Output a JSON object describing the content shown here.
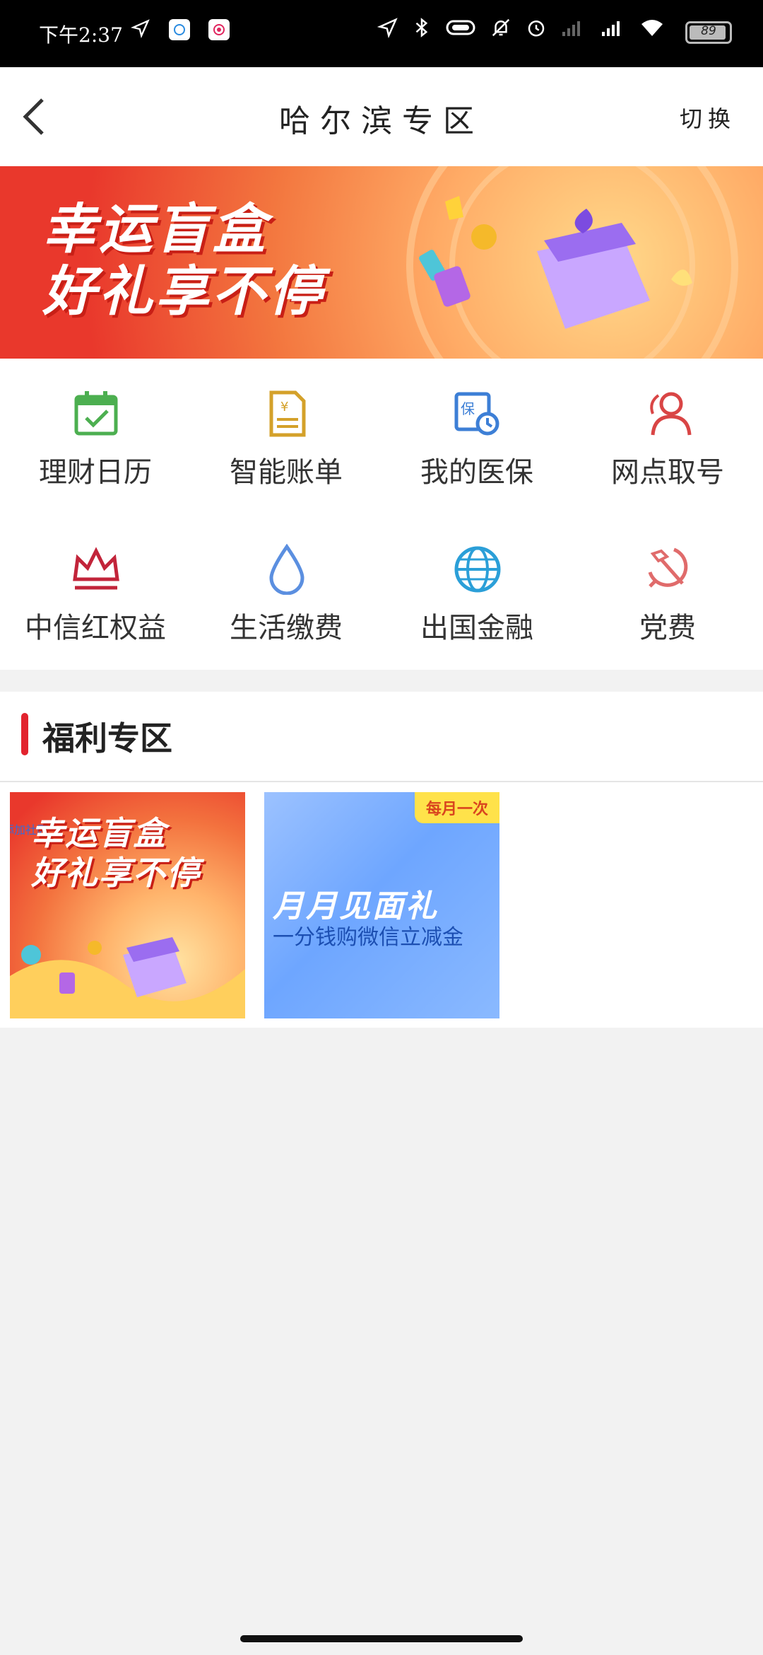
{
  "status_bar": {
    "time": "下午2:37",
    "battery": "89"
  },
  "nav": {
    "title": "哈尔滨专区",
    "switch_label": "切换"
  },
  "banner": {
    "line1": "幸运盲盒",
    "line2": "好礼享不停",
    "page_count": 2,
    "current_page": 1
  },
  "quick_actions": [
    {
      "label": "理财日历",
      "icon": "calendar-check-icon",
      "color": "#4caf50"
    },
    {
      "label": "智能账单",
      "icon": "bill-icon",
      "color": "#d4a12a"
    },
    {
      "label": "我的医保",
      "icon": "medical-insurance-icon",
      "color": "#3d7fd6"
    },
    {
      "label": "网点取号",
      "icon": "queue-number-icon",
      "color": "#d94545"
    },
    {
      "label": "中信红权益",
      "icon": "crown-icon",
      "color": "#c2243a"
    },
    {
      "label": "生活缴费",
      "icon": "water-drop-icon",
      "color": "#5b8fe0"
    },
    {
      "label": "出国金融",
      "icon": "globe-icon",
      "color": "#2b9fd8"
    },
    {
      "label": "党费",
      "icon": "hammer-sickle-icon",
      "color": "#e06b6b"
    }
  ],
  "welfare": {
    "title": "福利专区",
    "cards": [
      {
        "line1": "幸运盲盒",
        "line2": "好礼享不停",
        "tag": "添加社区"
      },
      {
        "badge": "每月一次",
        "title": "月月见面礼",
        "subtitle": "一分钱购微信立减金"
      }
    ]
  }
}
